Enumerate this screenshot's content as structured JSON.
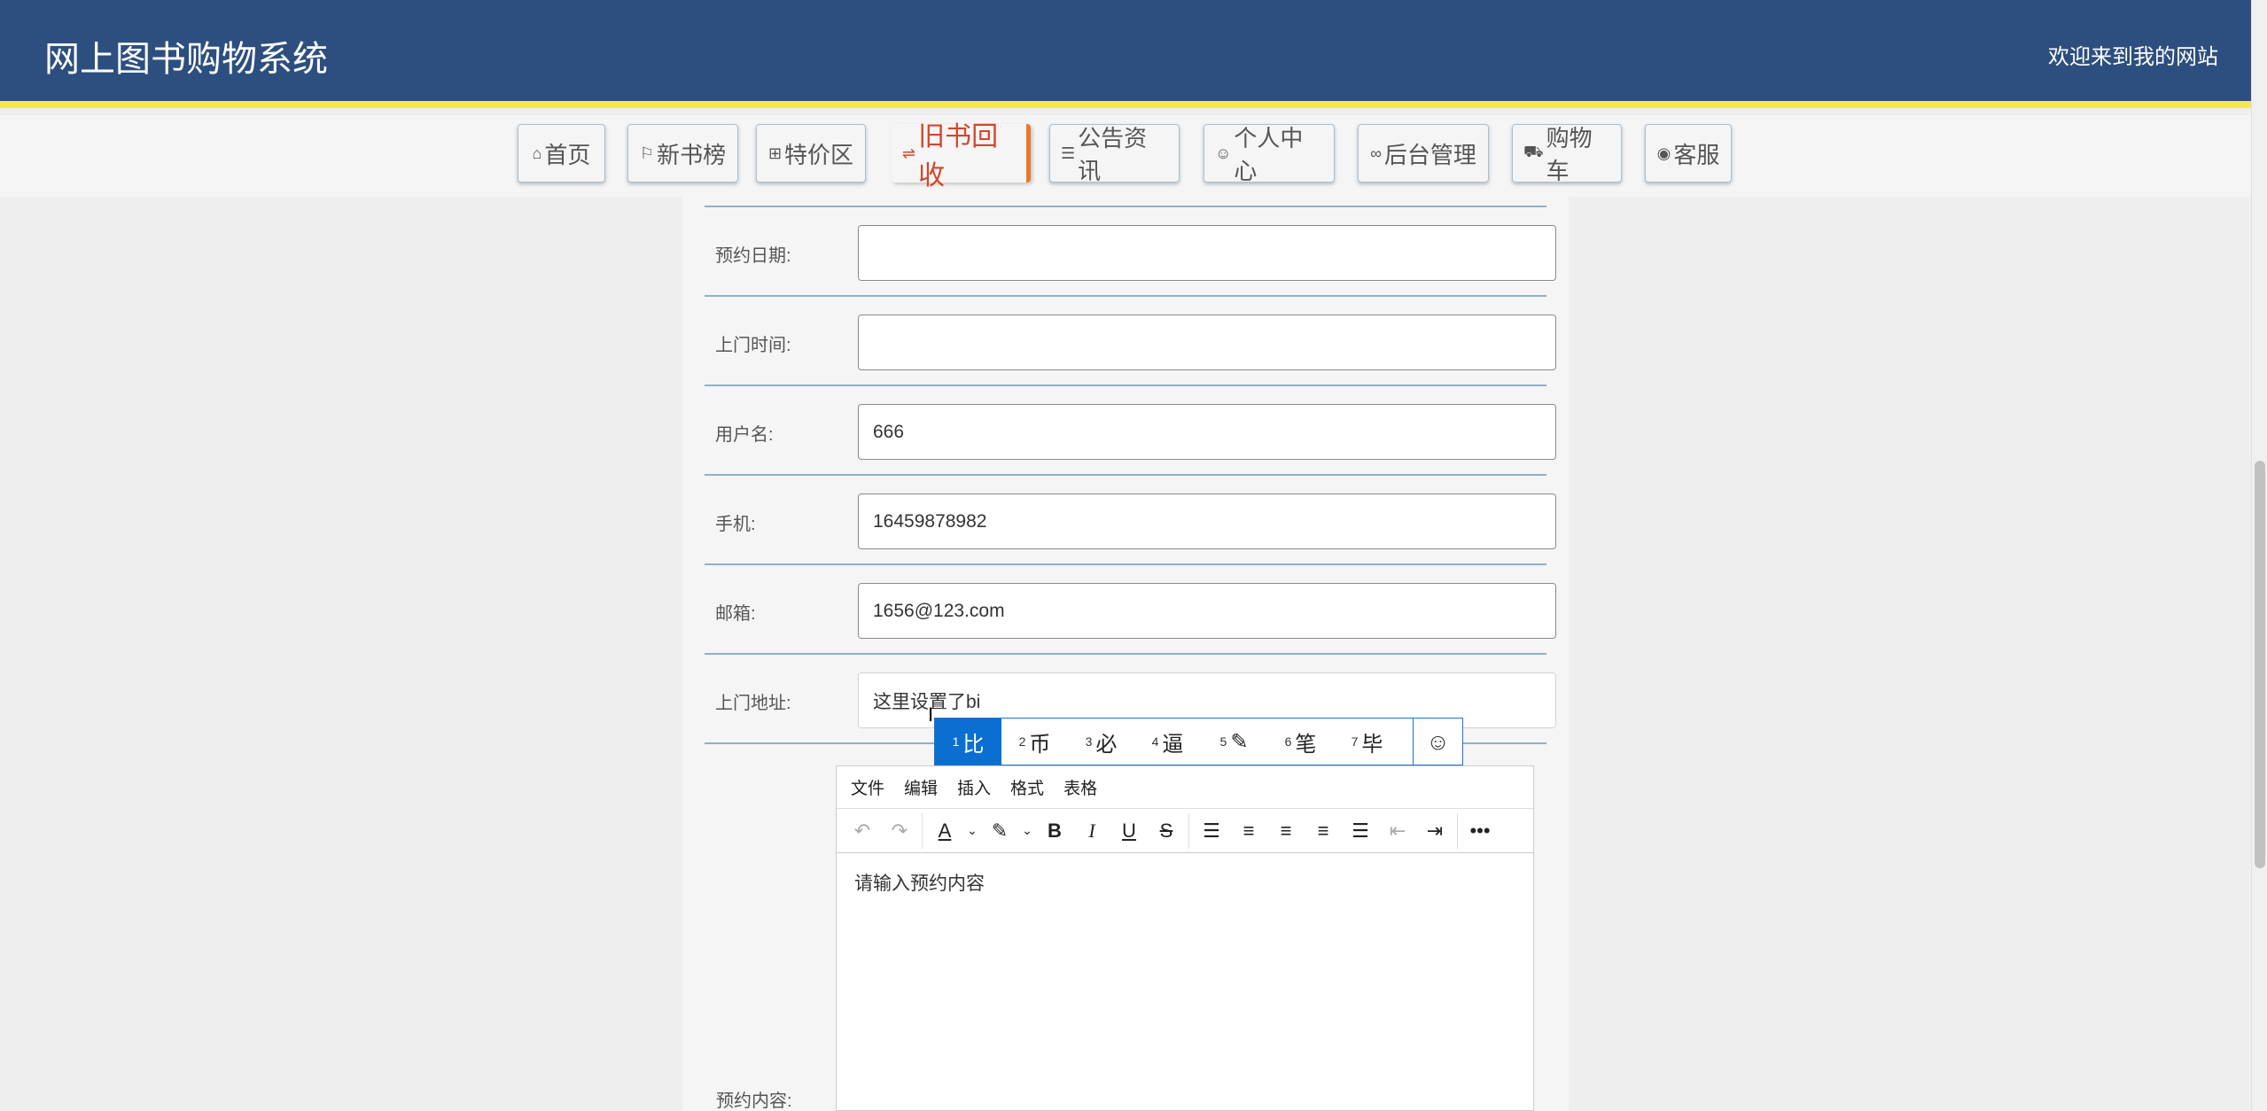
{
  "header": {
    "title": "网上图书购物系统",
    "welcome": "欢迎来到我的网站"
  },
  "nav": {
    "items": [
      {
        "icon": "⌂",
        "label": "首页"
      },
      {
        "icon": "⚐",
        "label": "新书榜"
      },
      {
        "icon": "⊞",
        "label": "特价区"
      },
      {
        "icon": "⇌",
        "label": "旧书回收"
      },
      {
        "icon": "☰",
        "label": "公告资讯"
      },
      {
        "icon": "☺",
        "label": "个人中心"
      },
      {
        "icon": "∞",
        "label": "后台管理"
      },
      {
        "icon": "⛟",
        "label": "购物车"
      },
      {
        "icon": "◉",
        "label": "客服"
      }
    ]
  },
  "form": {
    "date_label": "预约日期:",
    "date_value": "",
    "time_label": "上门时间:",
    "time_value": "",
    "username_label": "用户名:",
    "username_value": "666",
    "phone_label": "手机:",
    "phone_value": "16459878982",
    "email_label": "邮箱:",
    "email_value": "1656@123.com",
    "address_label": "上门地址:",
    "address_value": "这里设置了bi",
    "content_label": "预约内容:"
  },
  "ime": {
    "candidates": [
      {
        "n": "1",
        "t": "比"
      },
      {
        "n": "2",
        "t": "币"
      },
      {
        "n": "3",
        "t": "必"
      },
      {
        "n": "4",
        "t": "逼"
      },
      {
        "n": "5",
        "t": "✎"
      },
      {
        "n": "6",
        "t": "笔"
      },
      {
        "n": "7",
        "t": "毕"
      }
    ],
    "emoji": "☺"
  },
  "editor": {
    "menu": [
      "文件",
      "编辑",
      "插入",
      "格式",
      "表格"
    ],
    "placeholder": "请输入预约内容"
  }
}
